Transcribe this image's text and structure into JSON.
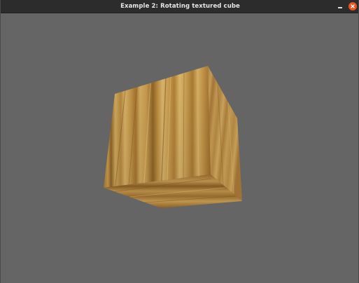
{
  "window": {
    "title": "Example 2: Rotating textured cube"
  },
  "controls": {
    "minimize_icon": "minimize-icon",
    "close_icon": "close-icon",
    "close_color": "#e95420"
  },
  "scene": {
    "background_color": "#656565",
    "object": "textured cube",
    "texture": "wood",
    "wood_colors": {
      "light": "#c9a050",
      "mid": "#b18438",
      "dark": "#7a5620"
    }
  }
}
